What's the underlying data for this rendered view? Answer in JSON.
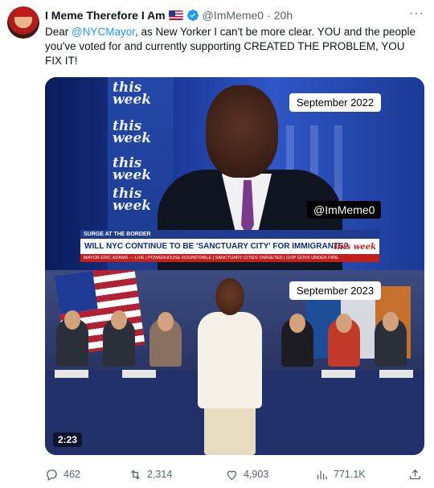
{
  "author": {
    "display_name": "I Meme Therefore I Am",
    "flag_icon": "us-flag-icon",
    "verified_icon": "verified-badge-icon",
    "handle": "@ImMeme0",
    "separator": "·",
    "timestamp": "20h"
  },
  "more_icon": "more-options-icon",
  "more_glyph": "···",
  "tweet": {
    "prefix": "Dear ",
    "mention": "@NYCMayor",
    "text": ", as New Yorker I can't be more clear. YOU and the people you've voted for and currently supporting CREATED THE PROBLEM, YOU FIX IT!"
  },
  "video": {
    "top_frame": {
      "date_label": "September  2022",
      "watermark": "@ImMeme0",
      "brand_words": [
        "this",
        "week"
      ],
      "chyron": {
        "kicker": "SURGE AT THE BORDER",
        "headline": "WILL NYC CONTINUE TO BE 'SANCTUARY CITY' FOR IMMIGRANTS?",
        "logo": "this week",
        "ticker": "MAYOR ERIC ADAMS — LIVE | POWERHOUSE ROUNDTABLE | SANCTUARY CITIES TARGETED | GOP GOVS UNDER FIRE"
      }
    },
    "bottom_frame": {
      "date_label": "September  2023"
    },
    "duration": "2:23"
  },
  "actions": {
    "replies": "462",
    "reposts": "2,314",
    "likes": "4,903",
    "views": "771.1K"
  },
  "colors": {
    "accent": "#1d9bf0",
    "secondary_text": "#536471",
    "primary_text": "#0f1419"
  }
}
